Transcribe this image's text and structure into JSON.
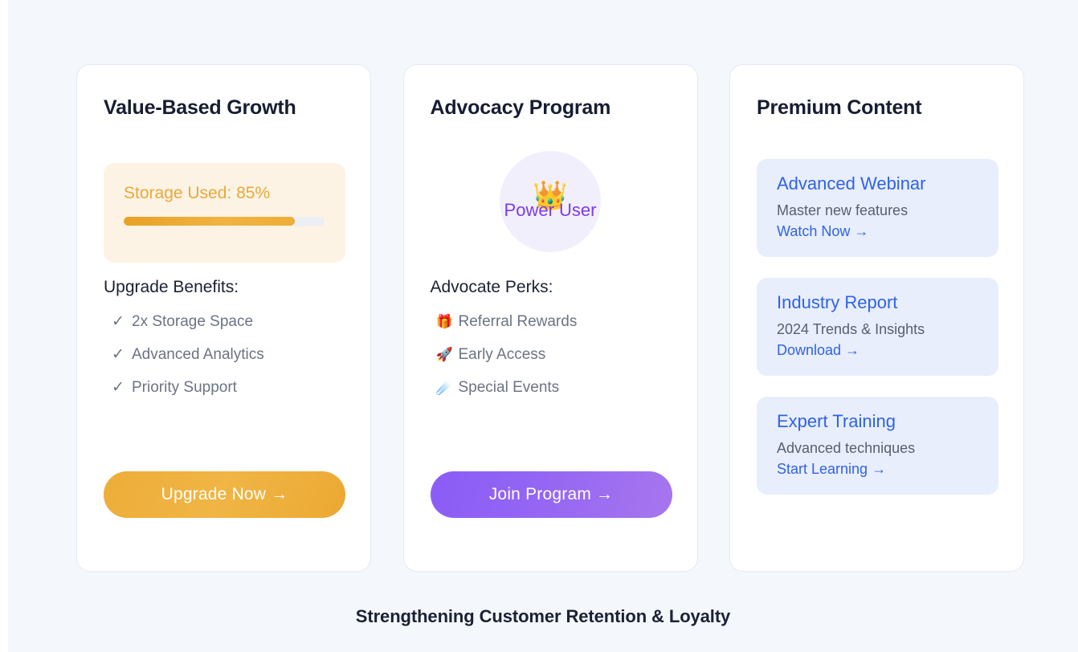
{
  "footer": {
    "tagline": "Strengthening Customer Retention & Loyalty"
  },
  "theme": {
    "page_background": "#f4f7fb",
    "card_background": "#ffffff",
    "card_border": "#e5e9f2",
    "amber": "#e8a93a",
    "violet": "#7c3aed",
    "blue": "#2f62eb",
    "heading": "#171d31",
    "muted_text": "#6b7384"
  },
  "cards": [
    {
      "title": "Value-Based Growth",
      "storage": {
        "label": "Storage Used: 85%",
        "percent": 85,
        "fill_color": "#eeae38",
        "track_color": "#eceff4",
        "box_color": "#fdf3e4"
      },
      "list_heading": "Upgrade Benefits:",
      "benefits": [
        {
          "bullet": "✓",
          "label": "2x Storage Space"
        },
        {
          "bullet": "✓",
          "label": "Advanced Analytics"
        },
        {
          "bullet": "✓",
          "label": "Priority Support"
        }
      ],
      "cta": "Upgrade Now  →"
    },
    {
      "title": "Advocacy Program",
      "badge": {
        "emoji": "👑",
        "emoji_name": "crown-icon",
        "caption": "Power User",
        "circle_color": "#f2effc",
        "caption_color": "#7c3aed"
      },
      "list_heading": "Advocate Perks:",
      "perks": [
        {
          "bullet": "🎁",
          "bullet_name": "gift-icon",
          "label": "Referral Rewards"
        },
        {
          "bullet": "🚀",
          "bullet_name": "rocket-icon",
          "label": "Early Access"
        },
        {
          "bullet": "☄️",
          "bullet_name": "comet-icon",
          "label": "Special Events"
        }
      ],
      "cta": "Join Program  →"
    },
    {
      "title": "Premium Content",
      "items": [
        {
          "title": "Advanced Webinar",
          "description": "Master new features",
          "link": "Watch Now  →"
        },
        {
          "title": "Industry Report",
          "description": "2024 Trends & Insights",
          "link": "Download  →"
        },
        {
          "title": "Expert Training",
          "description": "Advanced techniques",
          "link": "Start Learning  →"
        }
      ]
    }
  ]
}
